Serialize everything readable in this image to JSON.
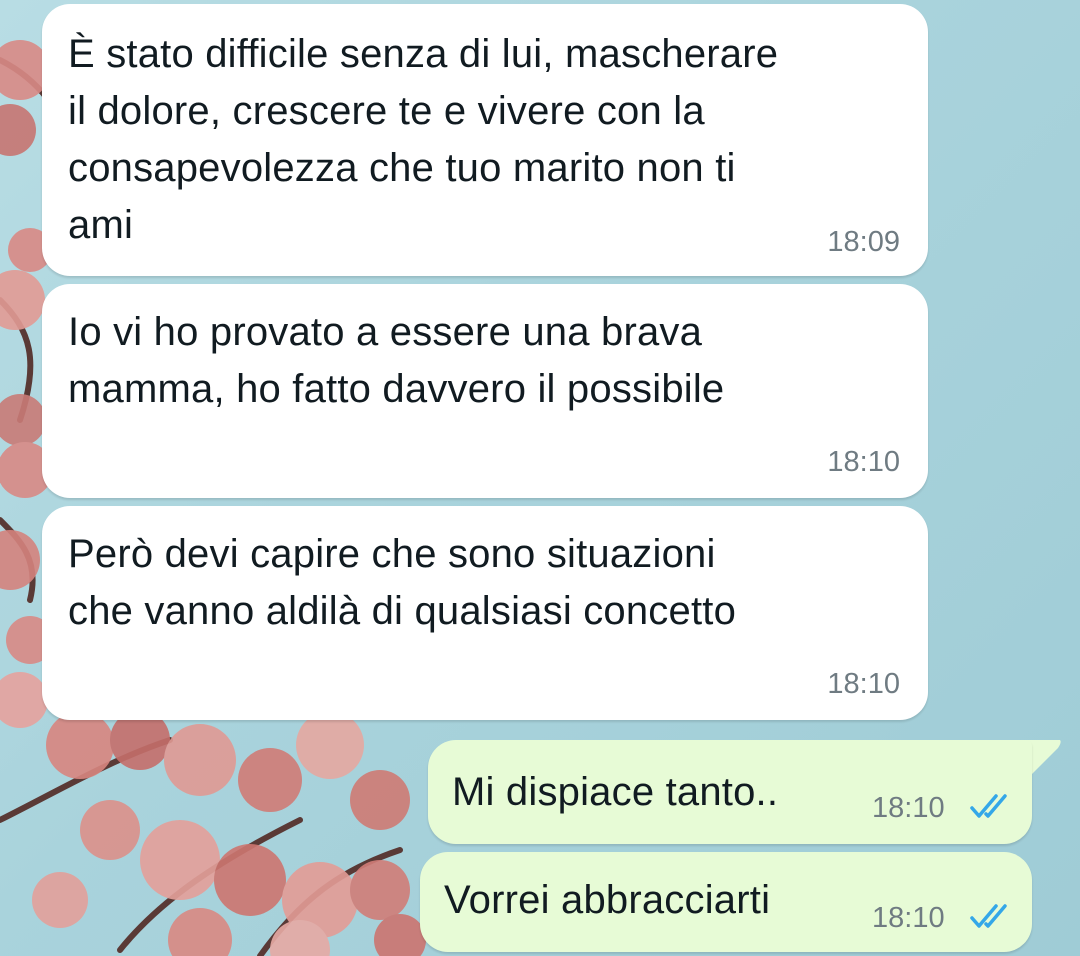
{
  "chat": {
    "wallpaper": "pink-blossom-branches-on-light-blue",
    "colors": {
      "incoming_bubble": "#ffffff",
      "outgoing_bubble": "#e7fbd6",
      "timestamp": "#6f7b82",
      "read_ticks": "#34a7e8"
    },
    "messages": [
      {
        "direction": "incoming",
        "lines": [
          "È stato difficile senza di lui, mascherare",
          "il dolore, crescere te e vivere con la",
          "consapevolezza che tuo marito non ti",
          "ami"
        ],
        "time": "18:09"
      },
      {
        "direction": "incoming",
        "lines": [
          "Io vi ho provato a essere una brava",
          "mamma, ho fatto davvero il possibile"
        ],
        "time": "18:10"
      },
      {
        "direction": "incoming",
        "lines": [
          "Però devi capire che sono situazioni",
          "che vanno aldilà di qualsiasi concetto"
        ],
        "time": "18:10"
      },
      {
        "direction": "outgoing",
        "text": "Mi dispiace tanto..",
        "time": "18:10",
        "status_icon": "double-check-read-icon"
      },
      {
        "direction": "outgoing",
        "text": "Vorrei abbracciarti",
        "time": "18:10",
        "status_icon": "double-check-read-icon"
      }
    ]
  }
}
